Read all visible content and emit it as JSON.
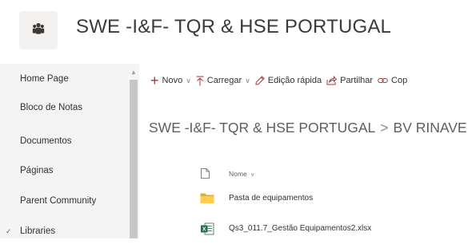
{
  "site": {
    "title": "SWE -I&F- TQR & HSE PORTUGAL",
    "logo_icon": "group-people-icon"
  },
  "nav": {
    "items": [
      {
        "label": "Home Page",
        "name": "nav-item-home-page"
      },
      {
        "label": "Bloco de Notas",
        "name": "nav-item-bloco-de-notas"
      },
      {
        "label": "Documentos",
        "name": "nav-item-documentos"
      },
      {
        "label": "Páginas",
        "name": "nav-item-paginas"
      },
      {
        "label": "Parent Community",
        "name": "nav-item-parent-community"
      },
      {
        "label": "Libraries",
        "name": "nav-item-libraries",
        "expander": "✓"
      }
    ]
  },
  "commandbar": {
    "new_label": "Novo",
    "upload_label": "Carregar",
    "quickedit_label": "Edição rápida",
    "share_label": "Partilhar",
    "copy_label": "Cop",
    "accent": "#a4373a"
  },
  "breadcrumb": {
    "parts": [
      "SWE -I&F- TQR & HSE PORTUGAL",
      "BV RINAVE"
    ],
    "separator": ">",
    "trailing": "("
  },
  "list": {
    "name_header": "Nome",
    "items": [
      {
        "name": "Pasta de equipamentos",
        "type": "folder",
        "icon": "folder-icon"
      },
      {
        "name": "Qs3_011.7_Gestão Equipamentos2.xlsx",
        "type": "excel",
        "icon": "excel-file-icon"
      }
    ]
  }
}
